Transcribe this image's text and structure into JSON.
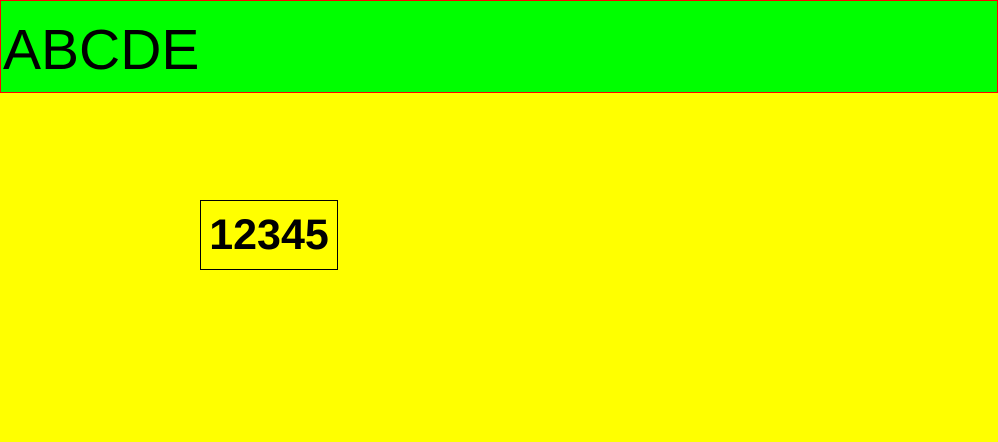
{
  "header": {
    "text": "ABCDE"
  },
  "content": {
    "boxed_text": "12345"
  },
  "colors": {
    "background": "#ffff00",
    "header_background": "#00ff00",
    "header_border": "#ff0000",
    "text": "#000000",
    "box_border": "#000000"
  }
}
